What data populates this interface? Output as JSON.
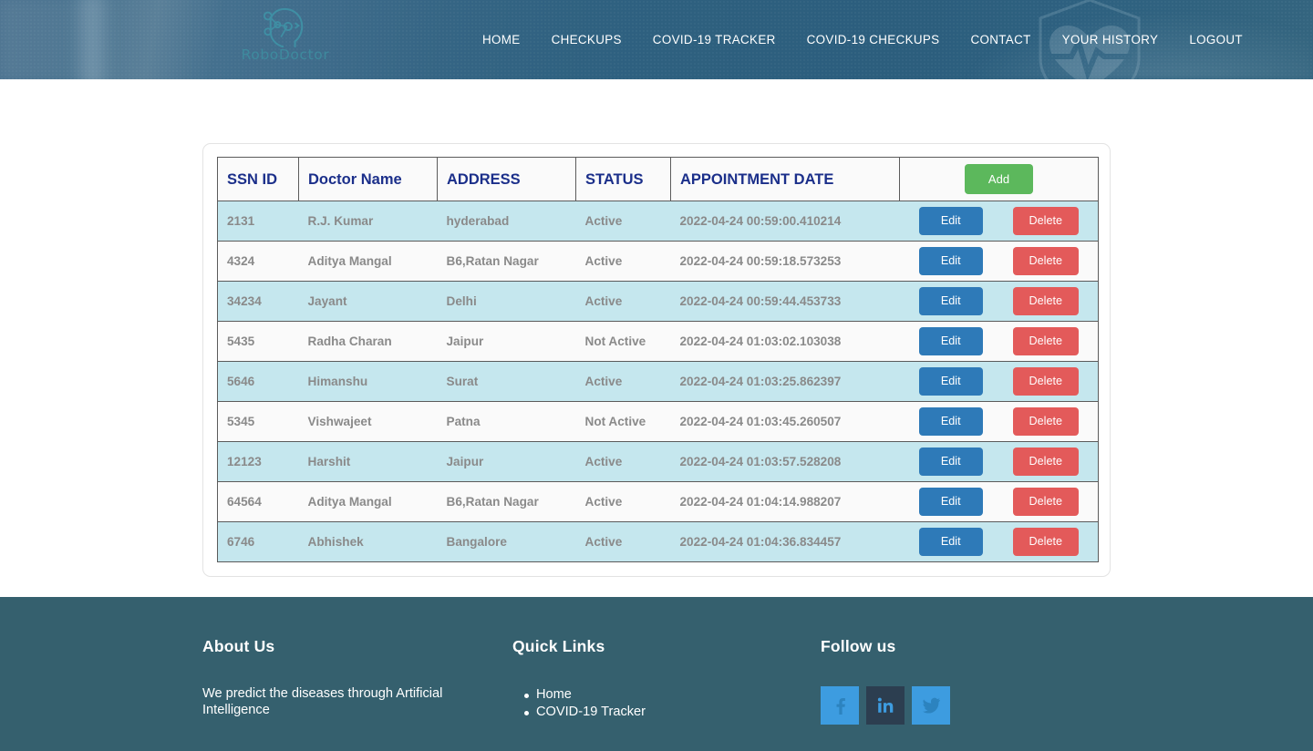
{
  "header": {
    "brand": {
      "name": "RoboDoctor",
      "logo_icon": "robot-head-network-icon"
    },
    "nav": [
      {
        "label": "HOME",
        "name": "nav-home"
      },
      {
        "label": "CHECKUPS",
        "name": "nav-checkups"
      },
      {
        "label": "COVID-19 TRACKER",
        "name": "nav-covid-tracker"
      },
      {
        "label": "COVID-19 CHECKUPS",
        "name": "nav-covid-checkups"
      },
      {
        "label": "CONTACT",
        "name": "nav-contact"
      },
      {
        "label": "YOUR HISTORY",
        "name": "nav-your-history"
      },
      {
        "label": "LOGOUT",
        "name": "nav-logout"
      }
    ],
    "watermark_icon": "heart-pulse-shield-icon"
  },
  "table": {
    "columns": [
      "SSN ID",
      "Doctor Name",
      "ADDRESS",
      "STATUS",
      "APPOINTMENT DATE"
    ],
    "add_label": "Add",
    "edit_label": "Edit",
    "delete_label": "Delete",
    "rows": [
      {
        "ssn": "2131",
        "doctor": "R.J. Kumar",
        "address": "hyderabad",
        "status": "Active",
        "date": "2022-04-24 00:59:00.410214"
      },
      {
        "ssn": "4324",
        "doctor": "Aditya Mangal",
        "address": "B6,Ratan Nagar",
        "status": "Active",
        "date": "2022-04-24 00:59:18.573253"
      },
      {
        "ssn": "34234",
        "doctor": "Jayant",
        "address": "Delhi",
        "status": "Active",
        "date": "2022-04-24 00:59:44.453733"
      },
      {
        "ssn": "5435",
        "doctor": "Radha Charan",
        "address": "Jaipur",
        "status": "Not Active",
        "date": "2022-04-24 01:03:02.103038"
      },
      {
        "ssn": "5646",
        "doctor": "Himanshu",
        "address": "Surat",
        "status": "Active",
        "date": "2022-04-24 01:03:25.862397"
      },
      {
        "ssn": "5345",
        "doctor": "Vishwajeet",
        "address": "Patna",
        "status": "Not Active",
        "date": "2022-04-24 01:03:45.260507"
      },
      {
        "ssn": "12123",
        "doctor": "Harshit",
        "address": "Jaipur",
        "status": "Active",
        "date": "2022-04-24 01:03:57.528208"
      },
      {
        "ssn": "64564",
        "doctor": "Aditya Mangal",
        "address": "B6,Ratan Nagar",
        "status": "Active",
        "date": "2022-04-24 01:04:14.988207"
      },
      {
        "ssn": "6746",
        "doctor": "Abhishek",
        "address": "Bangalore",
        "status": "Active",
        "date": "2022-04-24 01:04:36.834457"
      }
    ]
  },
  "footer": {
    "about": {
      "title": "About Us",
      "text": "We predict the diseases through Artificial Intelligence"
    },
    "quick_links": {
      "title": "Quick Links",
      "items": [
        {
          "label": "Home",
          "name": "footer-link-home"
        },
        {
          "label": "COVID-19 Tracker",
          "name": "footer-link-covid-tracker"
        }
      ]
    },
    "social": {
      "title": "Follow us",
      "items": [
        {
          "icon": "facebook-icon",
          "name": "social-facebook",
          "color": "#3d9ce0"
        },
        {
          "icon": "linkedin-icon",
          "name": "social-linkedin",
          "color": "#2c3e50"
        },
        {
          "icon": "twitter-icon",
          "name": "social-twitter",
          "color": "#3d9ce0"
        }
      ]
    }
  },
  "colors": {
    "header_blue": "#2d5f7e",
    "footer_teal": "#35606e",
    "header_text_blue": "#1b2f8a",
    "row_alt": "#c5e7ee",
    "row_base": "#fafafa",
    "add_green": "#5cb85c",
    "edit_blue": "#2e7ab8",
    "delete_red": "#e35a5a",
    "brand_teal": "#3e8da0"
  }
}
